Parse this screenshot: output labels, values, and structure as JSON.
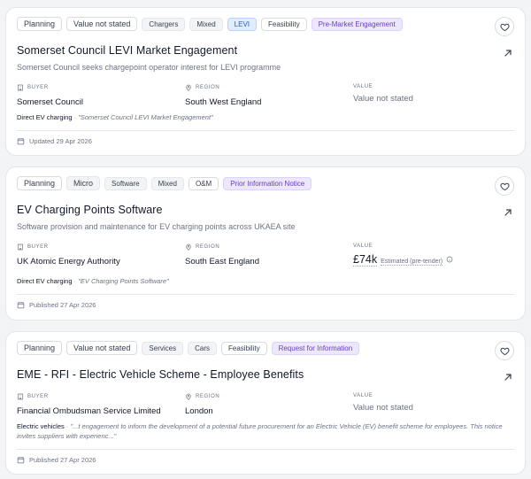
{
  "tenders": [
    {
      "tags": [
        "Planning",
        "Value not stated",
        "Chargers",
        "Mixed",
        "LEVI",
        "Feasibility",
        "Pre-Market Engagement"
      ],
      "title": "Somerset Council LEVI Market Engagement",
      "subtitle": "Somerset Council seeks chargepoint operator interest for LEVI programme",
      "buyer_label": "BUYER",
      "buyer": "Somerset Council",
      "region_label": "REGION",
      "region": "South West England",
      "value_label": "VALUE",
      "value": "Value not stated",
      "match_category": "Direct EV charging",
      "match_sep": "·",
      "match_quote": "\"Somerset Council LEVI Market Engagement\"",
      "meta": "Updated 29 Apr 2026"
    },
    {
      "tags": [
        "Planning",
        "Micro",
        "Software",
        "Mixed",
        "O&M",
        "Prior Information Notice"
      ],
      "title": "EV Charging Points Software",
      "subtitle": "Software provision and maintenance for EV charging points across UKAEA site",
      "buyer_label": "BUYER",
      "buyer": "UK Atomic Energy Authority",
      "region_label": "REGION",
      "region": "South East England",
      "value_label": "VALUE",
      "value_amount": "£74k",
      "value_note": "Estimated (pre-tender)",
      "match_category": "Direct EV charging",
      "match_sep": "·",
      "match_quote": "\"EV Charging Points Software\"",
      "meta": "Published 27 Apr 2026"
    },
    {
      "tags": [
        "Planning",
        "Value not stated",
        "Services",
        "Cars",
        "Feasibility",
        "Request for Information"
      ],
      "title": "EME - RFI - Electric Vehicle Scheme - Employee Benefits",
      "subtitle": "",
      "buyer_label": "BUYER",
      "buyer": "Financial Ombudsman Service Limited",
      "region_label": "REGION",
      "region": "London",
      "value_label": "VALUE",
      "value": "Value not stated",
      "match_category": "Electric vehicles",
      "match_sep": "·",
      "match_quote": "\"...t engagement to inform the development of a potential future procurement for an Electric Vehicle (EV) benefit scheme for employees. This notice invites suppliers with experienc...\"",
      "meta": "Published 27 Apr 2026"
    }
  ],
  "icons": {
    "save": "heart-icon",
    "open": "arrow-up-right-icon",
    "buyer": "building-icon",
    "region": "map-pin-icon",
    "date": "calendar-icon",
    "info": "info-icon"
  },
  "colors": {
    "tag_blue_bg": "#e0ecff",
    "tag_purple_bg": "#ede7fb",
    "card_border": "#e3e5ea"
  }
}
